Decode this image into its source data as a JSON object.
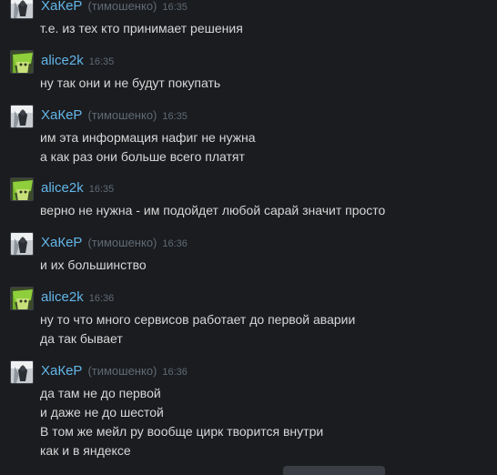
{
  "messages": [
    {
      "user": "ХаКеР",
      "alias": "(тимошенко)",
      "time": "16:35",
      "lines": [
        "т.е. из тех кто принимает решения"
      ]
    },
    {
      "user": "alice2k",
      "alias": "",
      "time": "16:35",
      "lines": [
        "ну так они и не будут покупать"
      ]
    },
    {
      "user": "ХаКеР",
      "alias": "(тимошенко)",
      "time": "16:35",
      "lines": [
        "им эта информация нафиг не нужна",
        "а как раз они больше всего платят"
      ]
    },
    {
      "user": "alice2k",
      "alias": "",
      "time": "16:35",
      "lines": [
        "верно не нужна - им подойдет любой сарай значит просто"
      ]
    },
    {
      "user": "ХаКеР",
      "alias": "(тимошенко)",
      "time": "16:36",
      "lines": [
        "и их большинство"
      ]
    },
    {
      "user": "alice2k",
      "alias": "",
      "time": "16:36",
      "lines": [
        "ну то что много сервисов работает до первой аварии",
        "да так бывает"
      ]
    },
    {
      "user": "ХаКеР",
      "alias": "(тимошенко)",
      "time": "16:36",
      "lines": [
        "да там не до первой",
        "и даже не до шестой",
        "В том же мейл ру вообще цирк творится внутри",
        "как и в яндексе"
      ]
    }
  ],
  "avatars": {
    "hacker": "hacker-avatar-icon",
    "alice": "alice-avatar-icon"
  },
  "colors": {
    "background": "#1b1c20",
    "username": "#62b6e8",
    "meta": "#5f6a74",
    "text": "#d7d7d7"
  }
}
